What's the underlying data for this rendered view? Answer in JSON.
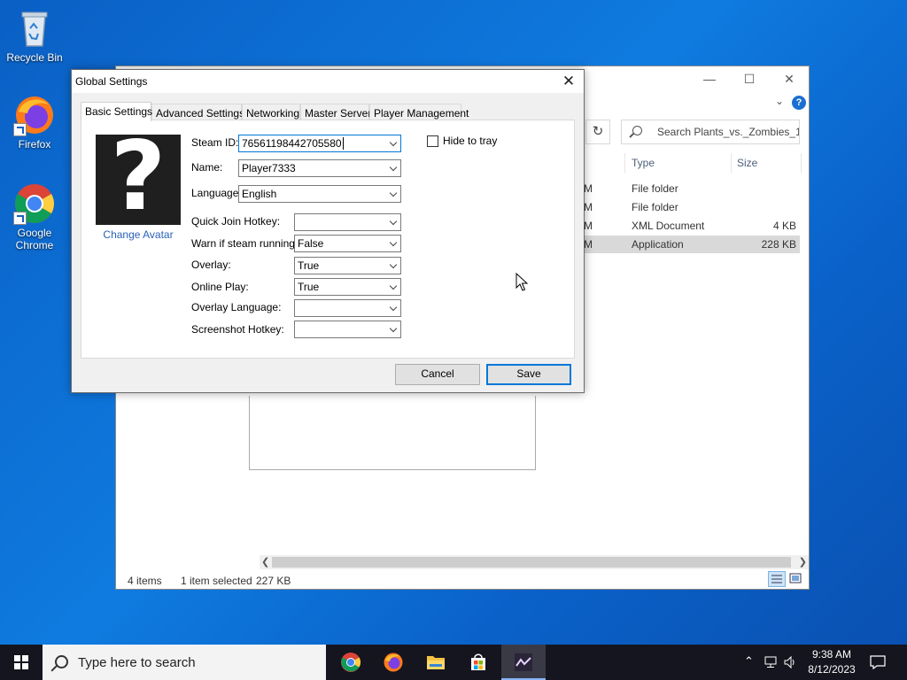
{
  "desktop": {
    "icons": [
      {
        "label": "Recycle Bin"
      },
      {
        "label": "Firefox"
      },
      {
        "label": "Google Chrome"
      }
    ]
  },
  "explorer": {
    "search_placeholder": "Search Plants_vs._Zombies_1...",
    "columns": {
      "type": "Type",
      "size": "Size"
    },
    "rows": [
      {
        "prefix": "M",
        "type": "File folder",
        "size": ""
      },
      {
        "prefix": "M",
        "type": "File folder",
        "size": ""
      },
      {
        "prefix": "M",
        "type": "XML Document",
        "size": "4 KB"
      },
      {
        "prefix": "M",
        "type": "Application",
        "size": "228 KB"
      }
    ],
    "status": {
      "items": "4 items",
      "selected": "1 item selected",
      "size": "227 KB"
    }
  },
  "dialog": {
    "title": "Global Settings",
    "tabs": [
      "Basic Settings",
      "Advanced Settings",
      "Networking",
      "Master Server",
      "Player Management"
    ],
    "active_tab": "Basic Settings",
    "change_avatar": "Change Avatar",
    "fields": {
      "steam_id": {
        "label": "Steam ID:",
        "value": "76561198442705580"
      },
      "name": {
        "label": "Name:",
        "value": "Player7333"
      },
      "language": {
        "label": "Language:",
        "value": "English"
      },
      "quick_join": {
        "label": "Quick Join Hotkey:",
        "value": ""
      },
      "warn_steam": {
        "label": "Warn if steam running:",
        "value": "False"
      },
      "overlay": {
        "label": "Overlay:",
        "value": "True"
      },
      "online_play": {
        "label": "Online Play:",
        "value": "True"
      },
      "overlay_language": {
        "label": "Overlay Language:",
        "value": ""
      },
      "screenshot_hotkey": {
        "label": "Screenshot Hotkey:",
        "value": ""
      }
    },
    "hide_to_tray": {
      "label": "Hide to tray",
      "checked": false
    },
    "buttons": {
      "cancel": "Cancel",
      "save": "Save"
    }
  },
  "taskbar": {
    "search_placeholder": "Type here to search",
    "time": "9:38 AM",
    "date": "8/12/2023"
  },
  "colors": {
    "accent": "#0078d7",
    "desktop": "#0f6fd8",
    "taskbar": "#15151f"
  }
}
